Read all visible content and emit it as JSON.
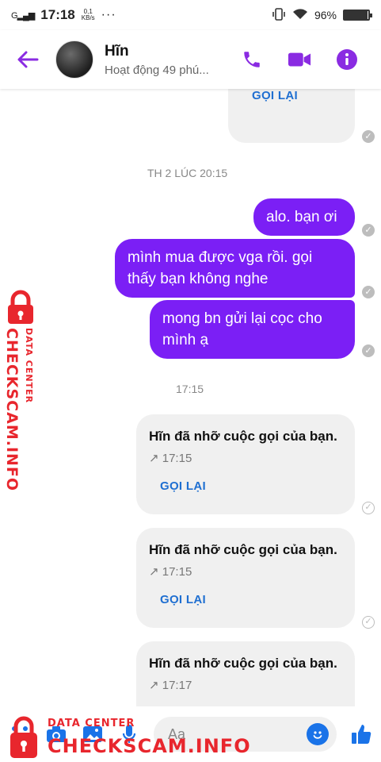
{
  "status_bar": {
    "signal": "G",
    "time": "17:18",
    "net_speed_value": "0,1",
    "net_speed_unit": "KB/s",
    "dots": "···",
    "battery": "96%"
  },
  "header": {
    "contact_name": "Hĩn",
    "presence": "Hoạt động 49 phú..."
  },
  "messages": {
    "call_back_top": "GỌI LẠI",
    "separator_1": "TH 2 LÚC 20:15",
    "sent_1": "alo. bạn ơi",
    "sent_2": "mình mua được vga rồi. gọi thấy bạn không nghe",
    "sent_3": "mong bn gửi lại cọc cho mình ạ",
    "separator_2": "17:15",
    "missed_calls": [
      {
        "title": "Hĩn đã nhỡ cuộc gọi của bạn.",
        "time": "17:15",
        "action": "GỌI LẠI"
      },
      {
        "title": "Hĩn đã nhỡ cuộc gọi của bạn.",
        "time": "17:15",
        "action": "GỌI LẠI"
      },
      {
        "title": "Hĩn đã nhỡ cuộc gọi của bạn.",
        "time": "17:17"
      }
    ]
  },
  "composer": {
    "placeholder": "Aa"
  },
  "watermark": {
    "side_small": "DATA CENTER",
    "side_big": "CHECKSCAM.INFO",
    "bottom_small": "DATA CENTER",
    "bottom_big": "CHECKSCAM.INFO"
  },
  "colors": {
    "accent": "#8a2be2",
    "sent_bubble": "#7b1ff5",
    "link_blue": "#1f6fd1",
    "watermark_red": "#e8262d"
  }
}
